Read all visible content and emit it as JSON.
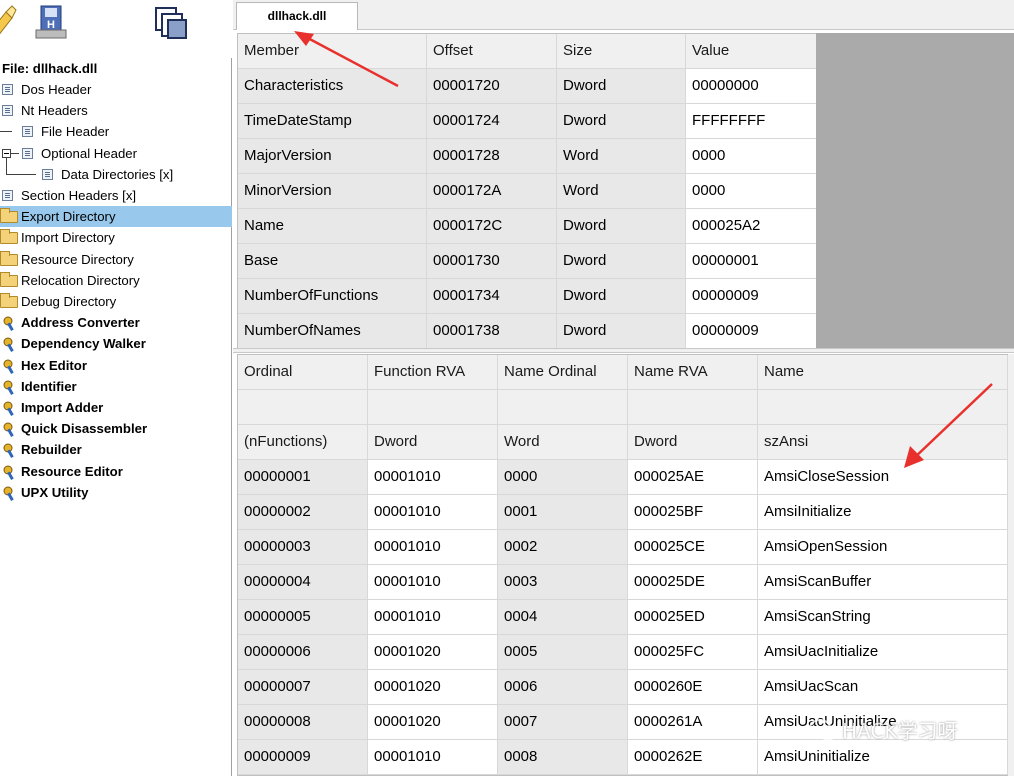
{
  "toolbar": {
    "icons": [
      "open-icon",
      "save-icon",
      "windows-icon"
    ]
  },
  "tree": {
    "file_label": "File: dllhack.dll",
    "items": [
      {
        "label": "Dos Header"
      },
      {
        "label": "Nt Headers"
      },
      {
        "label": "File Header"
      },
      {
        "label": "Optional Header"
      },
      {
        "label": "Data Directories [x]"
      },
      {
        "label": "Section Headers [x]"
      },
      {
        "label": "Export Directory"
      },
      {
        "label": "Import Directory"
      },
      {
        "label": "Resource Directory"
      },
      {
        "label": "Relocation Directory"
      },
      {
        "label": "Debug Directory"
      }
    ],
    "tools": [
      {
        "label": "Address Converter"
      },
      {
        "label": "Dependency Walker"
      },
      {
        "label": "Hex Editor"
      },
      {
        "label": "Identifier"
      },
      {
        "label": "Import Adder"
      },
      {
        "label": "Quick Disassembler"
      },
      {
        "label": "Rebuilder"
      },
      {
        "label": "Resource Editor"
      },
      {
        "label": "UPX Utility"
      }
    ]
  },
  "tab": {
    "label": "dllhack.dll"
  },
  "top_table": {
    "headers": [
      "Member",
      "Offset",
      "Size",
      "Value"
    ],
    "rows": [
      [
        "Characteristics",
        "00001720",
        "Dword",
        "00000000"
      ],
      [
        "TimeDateStamp",
        "00001724",
        "Dword",
        "FFFFFFFF"
      ],
      [
        "MajorVersion",
        "00001728",
        "Word",
        "0000"
      ],
      [
        "MinorVersion",
        "0000172A",
        "Word",
        "0000"
      ],
      [
        "Name",
        "0000172C",
        "Dword",
        "000025A2"
      ],
      [
        "Base",
        "00001730",
        "Dword",
        "00000001"
      ],
      [
        "NumberOfFunctions",
        "00001734",
        "Dword",
        "00000009"
      ],
      [
        "NumberOfNames",
        "00001738",
        "Dword",
        "00000009"
      ]
    ]
  },
  "bottom_table": {
    "headers": [
      "Ordinal",
      "Function RVA",
      "Name Ordinal",
      "Name RVA",
      "Name"
    ],
    "subheaders": [
      "(nFunctions)",
      "Dword",
      "Word",
      "Dword",
      "szAnsi"
    ],
    "rows": [
      [
        "00000001",
        "00001010",
        "0000",
        "000025AE",
        "AmsiCloseSession"
      ],
      [
        "00000002",
        "00001010",
        "0001",
        "000025BF",
        "AmsiInitialize"
      ],
      [
        "00000003",
        "00001010",
        "0002",
        "000025CE",
        "AmsiOpenSession"
      ],
      [
        "00000004",
        "00001010",
        "0003",
        "000025DE",
        "AmsiScanBuffer"
      ],
      [
        "00000005",
        "00001010",
        "0004",
        "000025ED",
        "AmsiScanString"
      ],
      [
        "00000006",
        "00001020",
        "0005",
        "000025FC",
        "AmsiUacInitialize"
      ],
      [
        "00000007",
        "00001020",
        "0006",
        "0000260E",
        "AmsiUacScan"
      ],
      [
        "00000008",
        "00001020",
        "0007",
        "0000261A",
        "AmsiUacUninitialize"
      ],
      [
        "00000009",
        "00001010",
        "0008",
        "0000262E",
        "AmsiUninitialize"
      ]
    ]
  },
  "watermark": {
    "text": "HACK学习呀"
  },
  "colors": {
    "selected": "#98c8eb",
    "arrow": "#e8312d",
    "gray_fill": "#aaaaaa"
  }
}
